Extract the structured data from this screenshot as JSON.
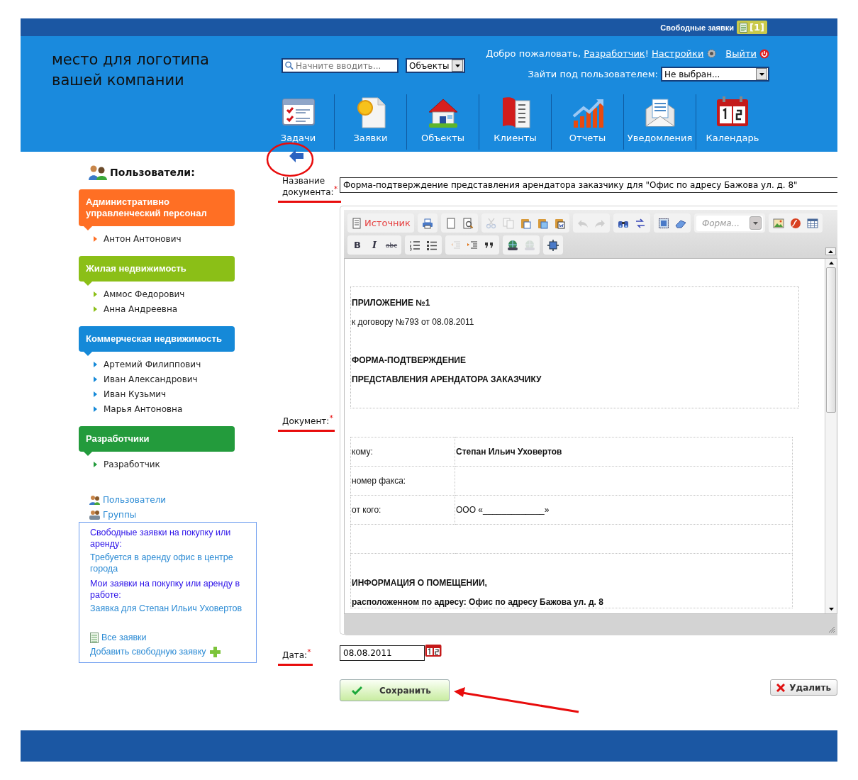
{
  "top_bar": {
    "link": "Свободные заявки",
    "badge": "[1]"
  },
  "header": {
    "logo": "место для логотипа\nвашей компании",
    "search": {
      "placeholder": "Начните вводить..."
    },
    "search_scope": "Объекты",
    "welcome": {
      "greeting": "Добро пожаловать, ",
      "user": "Разработчик",
      "exclaim": "!",
      "settings": "Настройки",
      "logout": "Выйти"
    },
    "impersonate": {
      "label": "Зайти под пользователем:",
      "value": "Не выбран..."
    }
  },
  "nav": [
    {
      "kind": "tasks",
      "label": "Задачи"
    },
    {
      "kind": "requests",
      "label": "Заявки"
    },
    {
      "kind": "objects",
      "label": "Объекты"
    },
    {
      "kind": "clients",
      "label": "Клиенты"
    },
    {
      "kind": "reports",
      "label": "Отчеты"
    },
    {
      "kind": "notifications",
      "label": "Уведомления"
    },
    {
      "kind": "calendar",
      "label": "Календарь"
    }
  ],
  "sidebar": {
    "title": "Пользователи:",
    "groups": [
      {
        "title": "Административно управленческий персонал",
        "color": "#ff6f24",
        "members": [
          "Антон Антонович"
        ]
      },
      {
        "title": "Жилая недвижимость",
        "color": "#8bbf17",
        "members": [
          "Аммос Федорович",
          "Анна Андреевна"
        ]
      },
      {
        "title": "Коммерческая недвижимость",
        "color": "#1589d8",
        "members": [
          "Артемий Филиппович",
          "Иван Александрович",
          "Иван Кузьмич",
          "Марья Антоновна"
        ]
      },
      {
        "title": "Разработчики",
        "color": "#239b3c",
        "members": [
          "Разработчик"
        ]
      }
    ],
    "links": [
      {
        "kind": "users",
        "label": "Пользователи"
      },
      {
        "kind": "groups",
        "label": "Группы"
      }
    ],
    "requests_box": [
      {
        "kind": "heading",
        "text": "Свободные заявки на покупку или аренду:"
      },
      {
        "kind": "link",
        "text": "Требуется в аренду офис в центре города"
      },
      {
        "kind": "heading",
        "text": "Мои заявки на покупку или аренду в работе:"
      },
      {
        "kind": "link",
        "text": "Заявка для Степан Ильич Уховертов"
      },
      {
        "kind": "all",
        "text": "Все заявки"
      },
      {
        "kind": "add",
        "text": "Добавить свободную заявку"
      }
    ]
  },
  "form": {
    "title_field": {
      "label": "Название документа:",
      "mark": "*",
      "value": "Форма-подтверждение представления арендатора заказчику для \"Офис по адресу Бажова ул. д. 8\""
    },
    "document_field": {
      "label": "Документ:",
      "mark": "*"
    },
    "editor": {
      "toolbar": [
        [
          [
            {
              "kind": "source",
              "label": "Источник",
              "disabled": false
            }
          ],
          [
            {
              "kind": "print",
              "disabled": false
            }
          ],
          [
            {
              "kind": "new-page",
              "disabled": false
            },
            {
              "kind": "preview",
              "disabled": false
            }
          ],
          [
            {
              "kind": "cut",
              "disabled": true
            },
            {
              "kind": "copy",
              "disabled": true
            },
            {
              "kind": "paste",
              "disabled": false
            },
            {
              "kind": "paste-text",
              "disabled": false
            },
            {
              "kind": "paste-word",
              "disabled": false
            }
          ],
          [
            {
              "kind": "undo",
              "disabled": true
            },
            {
              "kind": "redo",
              "disabled": true
            }
          ],
          [
            {
              "kind": "find",
              "disabled": false
            },
            {
              "kind": "replace",
              "disabled": false
            }
          ],
          [
            {
              "kind": "select-all",
              "disabled": false
            },
            {
              "kind": "eraser",
              "disabled": false
            }
          ],
          [
            {
              "kind": "format",
              "label": "Форма...",
              "disabled": false
            }
          ],
          [
            {
              "kind": "image",
              "disabled": false
            },
            {
              "kind": "flash",
              "disabled": false
            },
            {
              "kind": "table",
              "disabled": false
            }
          ]
        ],
        [
          [
            {
              "kind": "bold",
              "label": "B",
              "disabled": false
            },
            {
              "kind": "italic",
              "label": "I",
              "disabled": false
            },
            {
              "kind": "strike",
              "label": "abc",
              "disabled": false
            }
          ],
          [
            {
              "kind": "ol",
              "disabled": false
            },
            {
              "kind": "ul",
              "disabled": false
            }
          ],
          [
            {
              "kind": "outdent",
              "disabled": true
            },
            {
              "kind": "indent",
              "disabled": false
            },
            {
              "kind": "quote",
              "disabled": false
            }
          ],
          [
            {
              "kind": "link",
              "disabled": false
            },
            {
              "kind": "unlink",
              "disabled": true
            }
          ],
          [
            {
              "kind": "blocks",
              "disabled": false
            }
          ]
        ]
      ],
      "intro": [
        {
          "text": "ПРИЛОЖЕНИЕ №1",
          "bold": true
        },
        {
          "text": "к договору №793 от 08.08.2011",
          "bold": false
        },
        {
          "text": "ФОРМА-ПОДТВЕРЖДЕНИЕ",
          "bold": true
        },
        {
          "text": "ПРЕДСТАВЛЕНИЯ  АРЕНДАТОРА  ЗАКАЗЧИКУ",
          "bold": true
        }
      ],
      "table": [
        {
          "label": "кому:",
          "value": "Степан Ильич Уховертов",
          "bold": true
        },
        {
          "label": "номер факса:"
        },
        {
          "label": "от кого:",
          "value": "ООО «_____________»",
          "bold": false
        }
      ],
      "info": [
        "ИНФОРМАЦИЯ О ПОМЕЩЕНИИ,",
        "расположенном по адресу: Офис по адресу Бажова ул. д. 8"
      ]
    },
    "date_field": {
      "label": "Дата:",
      "mark": "*",
      "value": "08.08.2011"
    },
    "save": "Сохранить",
    "delete": "Удалить"
  }
}
